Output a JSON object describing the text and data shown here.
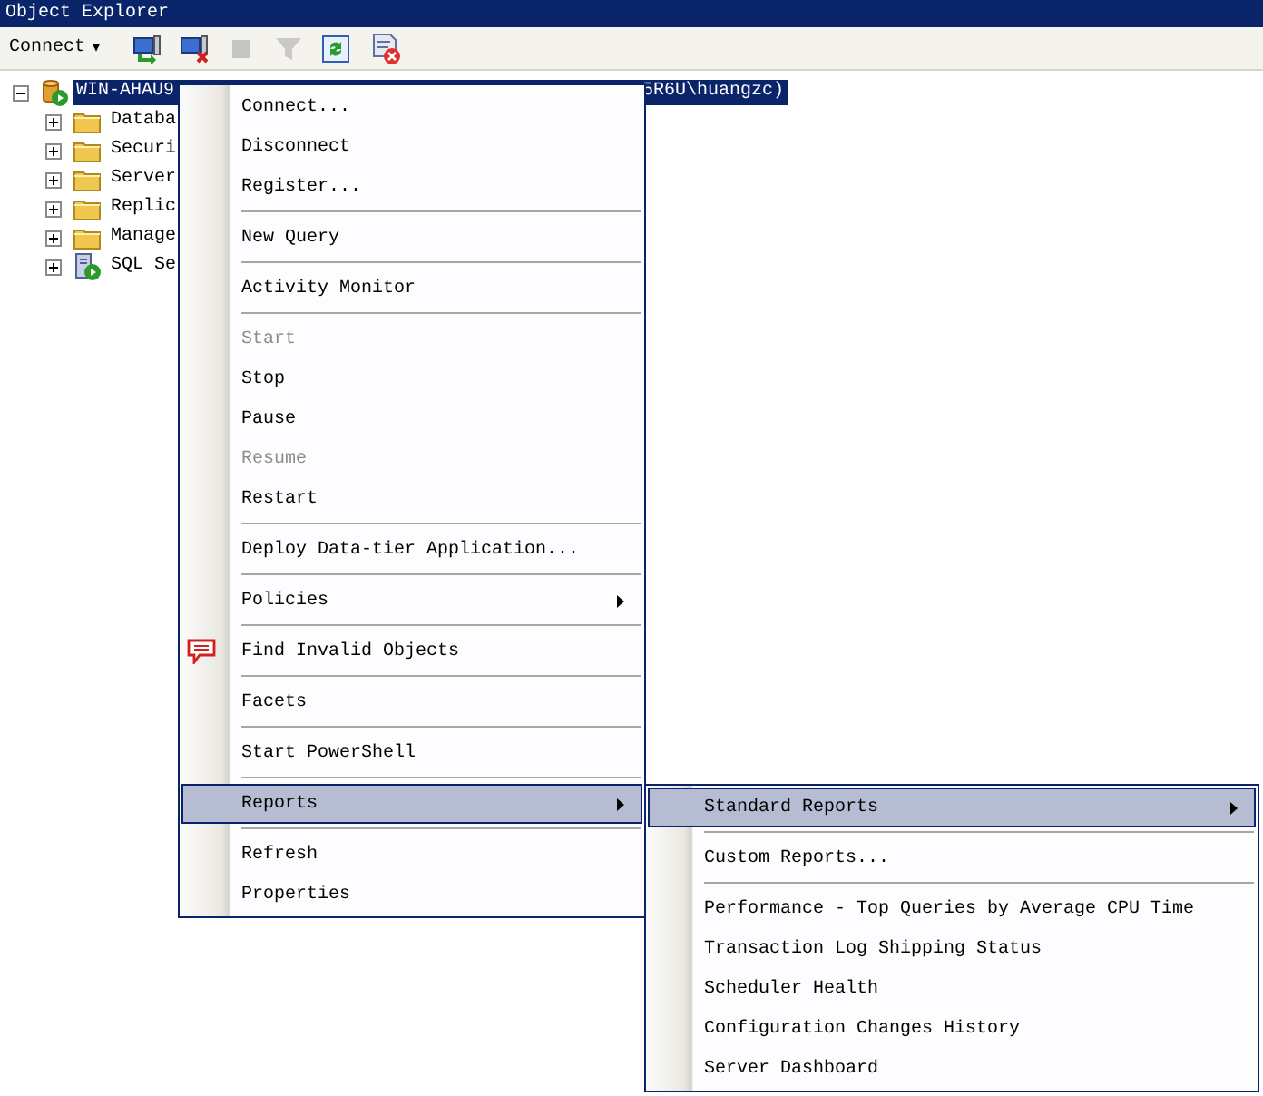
{
  "window": {
    "title": "Object Explorer"
  },
  "toolbar": {
    "connect": {
      "label": "Connect",
      "caret": "▾"
    },
    "buttons": [
      {
        "kind": "connect",
        "disabled": false
      },
      {
        "kind": "disconnect",
        "disabled": false
      },
      {
        "kind": "stop",
        "disabled": true
      },
      {
        "kind": "filter",
        "disabled": true
      },
      {
        "kind": "refresh",
        "disabled": false
      },
      {
        "kind": "delete",
        "disabled": false
      }
    ]
  },
  "tree": {
    "root": {
      "label": "WIN-AHAU9",
      "label_tail": "5R6U\\huangzc)",
      "expanded": true,
      "selected": true,
      "kind": "server",
      "children": [
        {
          "label": "Databa",
          "expanded": false,
          "kind": "folder"
        },
        {
          "label": "Securi",
          "expanded": false,
          "kind": "folder"
        },
        {
          "label": "Server",
          "expanded": false,
          "kind": "folder"
        },
        {
          "label": "Replic",
          "expanded": false,
          "kind": "folder"
        },
        {
          "label": "Manage",
          "expanded": false,
          "kind": "folder"
        },
        {
          "label": "SQL Se",
          "expanded": false,
          "kind": "agent"
        }
      ]
    }
  },
  "menu": {
    "items": [
      {
        "label": "Connect...",
        "disabled": false,
        "selected": false,
        "submenu": false,
        "separator_before": false
      },
      {
        "label": "Disconnect",
        "disabled": false,
        "selected": false,
        "submenu": false,
        "separator_before": false
      },
      {
        "label": "Register...",
        "disabled": false,
        "selected": false,
        "submenu": false,
        "separator_before": false
      },
      {
        "label": "New Query",
        "disabled": false,
        "selected": false,
        "submenu": false,
        "separator_before": true
      },
      {
        "label": "Activity Monitor",
        "disabled": false,
        "selected": false,
        "submenu": false,
        "separator_before": true
      },
      {
        "label": "Start",
        "disabled": true,
        "selected": false,
        "submenu": false,
        "separator_before": true
      },
      {
        "label": "Stop",
        "disabled": false,
        "selected": false,
        "submenu": false,
        "separator_before": false
      },
      {
        "label": "Pause",
        "disabled": false,
        "selected": false,
        "submenu": false,
        "separator_before": false
      },
      {
        "label": "Resume",
        "disabled": true,
        "selected": false,
        "submenu": false,
        "separator_before": false
      },
      {
        "label": "Restart",
        "disabled": false,
        "selected": false,
        "submenu": false,
        "separator_before": false
      },
      {
        "label": "Deploy Data-tier Application...",
        "disabled": false,
        "selected": false,
        "submenu": false,
        "separator_before": true
      },
      {
        "label": "Policies",
        "disabled": false,
        "selected": false,
        "submenu": true,
        "separator_before": true
      },
      {
        "label": "Find Invalid Objects",
        "disabled": false,
        "selected": false,
        "submenu": false,
        "separator_before": true,
        "kind": "bubble"
      },
      {
        "label": "Facets",
        "disabled": false,
        "selected": false,
        "submenu": false,
        "separator_before": true
      },
      {
        "label": "Start PowerShell",
        "disabled": false,
        "selected": false,
        "submenu": false,
        "separator_before": true
      },
      {
        "label": "Reports",
        "disabled": false,
        "selected": true,
        "submenu": true,
        "separator_before": true
      },
      {
        "label": "Refresh",
        "disabled": false,
        "selected": false,
        "submenu": false,
        "separator_before": true
      },
      {
        "label": "Properties",
        "disabled": false,
        "selected": false,
        "submenu": false,
        "separator_before": false
      }
    ]
  },
  "submenu": {
    "items": [
      {
        "label": "Standard Reports",
        "disabled": false,
        "selected": true,
        "submenu": true,
        "separator_before": false
      },
      {
        "label": "Custom Reports...",
        "disabled": false,
        "selected": false,
        "submenu": false,
        "separator_before": true
      },
      {
        "label": "Performance - Top Queries by Average CPU Time",
        "disabled": false,
        "selected": false,
        "submenu": false,
        "separator_before": true
      },
      {
        "label": "Transaction Log Shipping Status",
        "disabled": false,
        "selected": false,
        "submenu": false,
        "separator_before": false
      },
      {
        "label": "Scheduler Health",
        "disabled": false,
        "selected": false,
        "submenu": false,
        "separator_before": false
      },
      {
        "label": "Configuration Changes History",
        "disabled": false,
        "selected": false,
        "submenu": false,
        "separator_before": false
      },
      {
        "label": "Server Dashboard",
        "disabled": false,
        "selected": false,
        "submenu": false,
        "separator_before": false
      }
    ]
  }
}
